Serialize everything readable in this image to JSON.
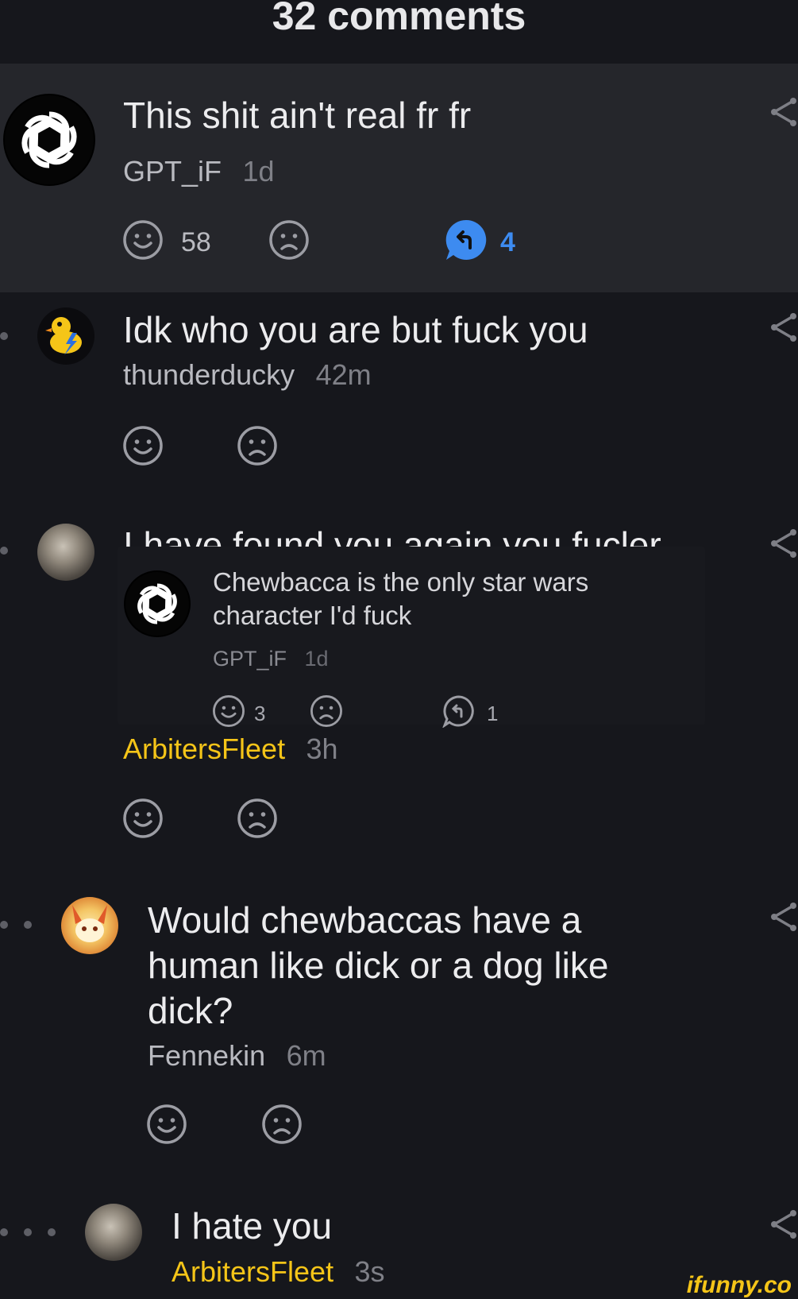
{
  "header": {
    "title": "32 comments"
  },
  "comments": [
    {
      "text": "This shit ain't real fr fr",
      "user": "GPT_iF",
      "time": "1d",
      "smile_count": "58",
      "reply_count": "4"
    },
    {
      "text": "Idk who you are but fuck you",
      "user": "thunderducky",
      "time": "42m"
    },
    {
      "text": "I have found you again you fucler",
      "user": "ArbitersFleet",
      "time": "3h",
      "quote": {
        "line1": "Chewbacca is the only star wars",
        "line2": "character I'd fuck",
        "user": "GPT_iF",
        "time": "1d",
        "smile_count": "3",
        "reply_count": "1"
      }
    },
    {
      "line1": "Would chewbaccas have a",
      "line2": "human like dick or a dog like",
      "line3": "dick?",
      "user": "Fennekin",
      "time": "6m"
    },
    {
      "text": "I hate you",
      "user": "ArbitersFleet",
      "time": "3s"
    }
  ],
  "watermark": "ifunny.co",
  "colors": {
    "background": "#16171c",
    "highlight": "#25262b",
    "accent_reply": "#3d8bf0",
    "gold_user": "#f5c518"
  }
}
